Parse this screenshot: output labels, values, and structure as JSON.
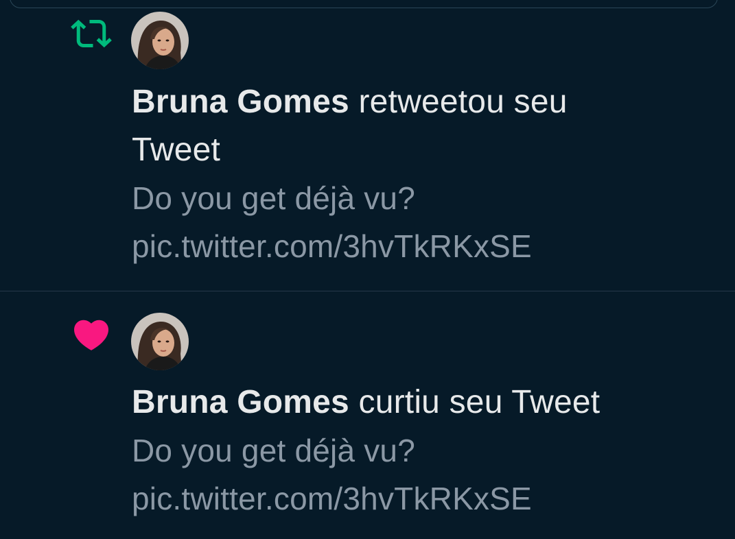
{
  "colors": {
    "background": "#061a28",
    "retweet_green": "#00ba7c",
    "like_pink": "#f91880",
    "primary_text": "#e7e9ea",
    "secondary_text": "#8b98a5"
  },
  "notifications": [
    {
      "icon": "retweet-icon",
      "user_name": "Bruna Gomes",
      "action": "retweetou seu Tweet",
      "tweet_text": "Do you get déjà vu?",
      "tweet_link": "pic.twitter.com/3hvTkRKxSE"
    },
    {
      "icon": "heart-icon",
      "user_name": "Bruna Gomes",
      "action": "curtiu seu Tweet",
      "tweet_text": "Do you get déjà vu?",
      "tweet_link": "pic.twitter.com/3hvTkRKxSE"
    }
  ]
}
